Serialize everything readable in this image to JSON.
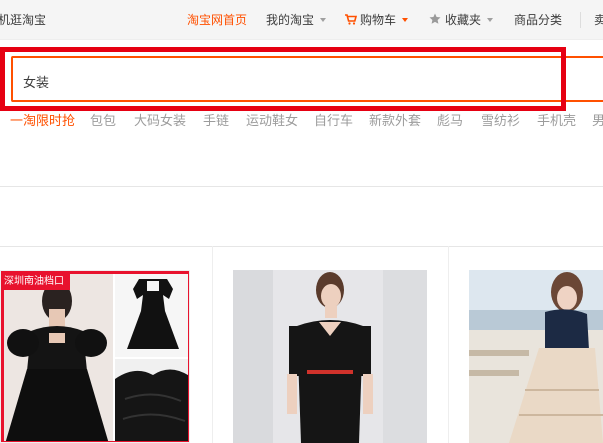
{
  "topbar": {
    "mobile_link": "机逛淘宝",
    "home": "淘宝网首页",
    "my_taobao": "我的淘宝",
    "cart": "购物车",
    "favorites": "收藏夹",
    "categories": "商品分类",
    "seller": "卖"
  },
  "search": {
    "value": "女装"
  },
  "hotwords": [
    "一淘限时抢",
    "包包",
    "大码女装",
    "手链",
    "运动鞋女",
    "自行车",
    "新款外套",
    "彪马",
    "雪纺衫",
    "手机壳",
    "男"
  ],
  "products": [
    {
      "badge": "深圳南油档口"
    }
  ],
  "colors": {
    "accent": "#ff5000",
    "highlight": "#e60012"
  }
}
